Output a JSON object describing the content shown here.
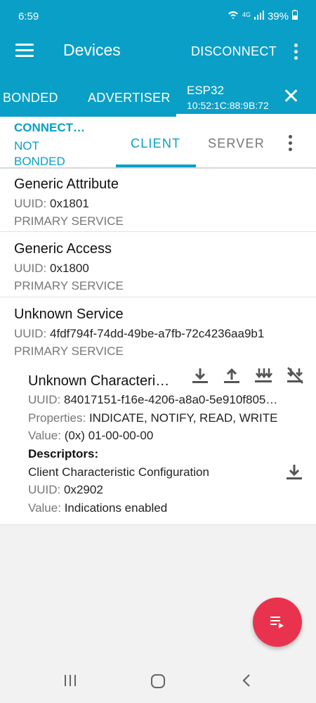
{
  "status": {
    "time": "6:59",
    "network": "4G",
    "battery": "39%"
  },
  "toolbar": {
    "title": "Devices",
    "disconnect_label": "DISCONNECT"
  },
  "tabs": {
    "bonded": "BONDED",
    "advertiser": "ADVERTISER",
    "device_name": "ESP32",
    "device_mac": "10:52:1C:88:9B:72"
  },
  "connection": {
    "state": "CONNECT…",
    "bond_state": "NOT BONDED",
    "client_tab": "CLIENT",
    "server_tab": "SERVER"
  },
  "services": [
    {
      "name": "Generic Attribute",
      "uuid_label": "UUID:",
      "uuid": "0x1801",
      "type": "PRIMARY SERVICE"
    },
    {
      "name": "Generic Access",
      "uuid_label": "UUID:",
      "uuid": "0x1800",
      "type": "PRIMARY SERVICE"
    },
    {
      "name": "Unknown Service",
      "uuid_label": "UUID:",
      "uuid": "4fdf794f-74dd-49be-a7fb-72c4236aa9b1",
      "type": "PRIMARY SERVICE"
    }
  ],
  "characteristic": {
    "name": "Unknown Characteri…",
    "uuid_label": "UUID:",
    "uuid": "84017151-f16e-4206-a8a0-5e910f805…",
    "properties_label": "Properties:",
    "properties": "INDICATE, NOTIFY, READ, WRITE",
    "value_label": "Value:",
    "value": "(0x) 01-00-00-00",
    "descriptors_label": "Descriptors:",
    "descriptor_name": "Client Characteristic Configuration",
    "descriptor_uuid_label": "UUID:",
    "descriptor_uuid": "0x2902",
    "descriptor_value_label": "Value:",
    "descriptor_value": "Indications enabled"
  },
  "colors": {
    "primary": "#0a9fc6",
    "fab": "#e9334e"
  }
}
